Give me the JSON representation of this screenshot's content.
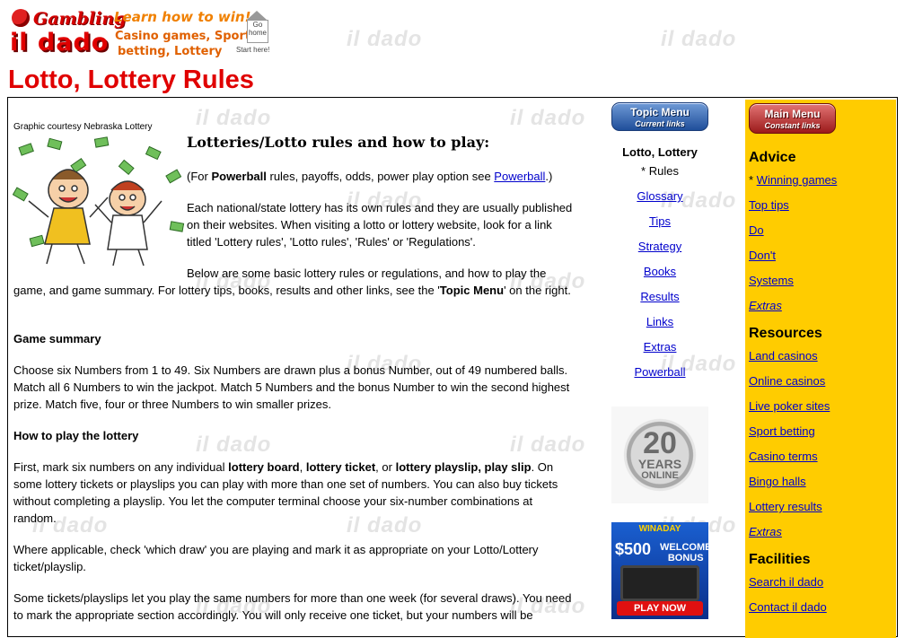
{
  "brand": {
    "logo_gambling": "Gambling",
    "logo_name": "il dado",
    "tagline": "Learn how to win!",
    "tagline2_line1": "Casino games, Sports",
    "tagline2_line2": "betting, Lottery",
    "home_label_1": "Go",
    "home_label_2": "home",
    "home_start": "Start here!",
    "watermark": "il dado"
  },
  "page_title": "Lotto, Lottery Rules",
  "article": {
    "caption": "Graphic courtesy Nebraska Lottery",
    "heading": "Lotteries/Lotto rules and how to play:",
    "p_powerball_prefix": "(For ",
    "p_powerball_bold": "Powerball",
    "p_powerball_mid": " rules, payoffs, odds, power play option see ",
    "p_powerball_link": "Powerball",
    "p_powerball_suffix": ".)",
    "p_rules": "Each national/state lottery has its own rules and they are usually published on their websites. When visiting a lotto or lottery website, look for a link titled 'Lottery rules', 'Lotto rules', 'Rules' or 'Regulations'.",
    "p_below_1": "Below are some basic lottery rules or regulations, and how to play the game, and game summary. For lottery tips, books, results and other links, see the '",
    "p_below_bold": "Topic Menu",
    "p_below_2": "' on the right.",
    "h_summary": "Game summary",
    "p_summary": "Choose six Numbers from 1 to 49. Six Numbers are drawn plus a bonus Number, out of 49 numbered balls. Match all 6 Numbers to win the jackpot. Match 5 Numbers and the bonus Number to win the second highest prize. Match five, four or three Numbers to win smaller prizes.",
    "h_howto": "How to play the lottery",
    "p_howto_1": "First, mark six numbers on any individual ",
    "p_howto_b1": "lottery board",
    "p_howto_c1": ", ",
    "p_howto_b2": "lottery ticket",
    "p_howto_c2": ", or ",
    "p_howto_b3": "lottery playslip, play slip",
    "p_howto_2": ". On some lottery tickets or playslips you can play with more than one set of numbers. You can also buy tickets without completing a playslip. You let the computer terminal choose your six-number combinations at random.",
    "p_where": "Where applicable, check 'which draw' you are playing and mark it as appropriate on your Lotto/Lottery ticket/playslip.",
    "p_some": "Some tickets/playslips let you play the same numbers for more than one week (for several draws). You need to mark the appropriate section accordingly. You will only receive one ticket, but your numbers will be"
  },
  "topic_menu": {
    "button_title": "Topic Menu",
    "button_sub": "Current links",
    "heading": "Lotto, Lottery",
    "current": "* Rules",
    "links": [
      "Glossary",
      "Tips",
      "Strategy",
      "Books",
      "Results",
      "Links",
      "Extras",
      "Powerball"
    ],
    "badge_number": "20",
    "badge_years": "YEARS",
    "badge_online": "ONLINE",
    "ad_brand": "WINADAY",
    "ad_amount": "$500",
    "ad_bonus_1": "WELCOME",
    "ad_bonus_2": "BONUS",
    "ad_cta": "PLAY NOW"
  },
  "main_menu": {
    "button_title": "Main Menu",
    "button_sub": "Constant links",
    "advice_heading": "Advice",
    "advice_current_prefix": "* ",
    "advice_links": [
      "Winning games",
      "Top tips",
      "Do",
      "Don't",
      "Systems"
    ],
    "advice_extras": "Extras",
    "resources_heading": "Resources",
    "resources_links": [
      "Land casinos",
      "Online casinos",
      "Live poker sites",
      "Sport betting",
      "Casino terms",
      "Bingo halls",
      "Lottery results"
    ],
    "resources_extras": "Extras",
    "facilities_heading": "Facilities",
    "facilities_links": [
      "Search il dado",
      "Contact il dado"
    ]
  }
}
